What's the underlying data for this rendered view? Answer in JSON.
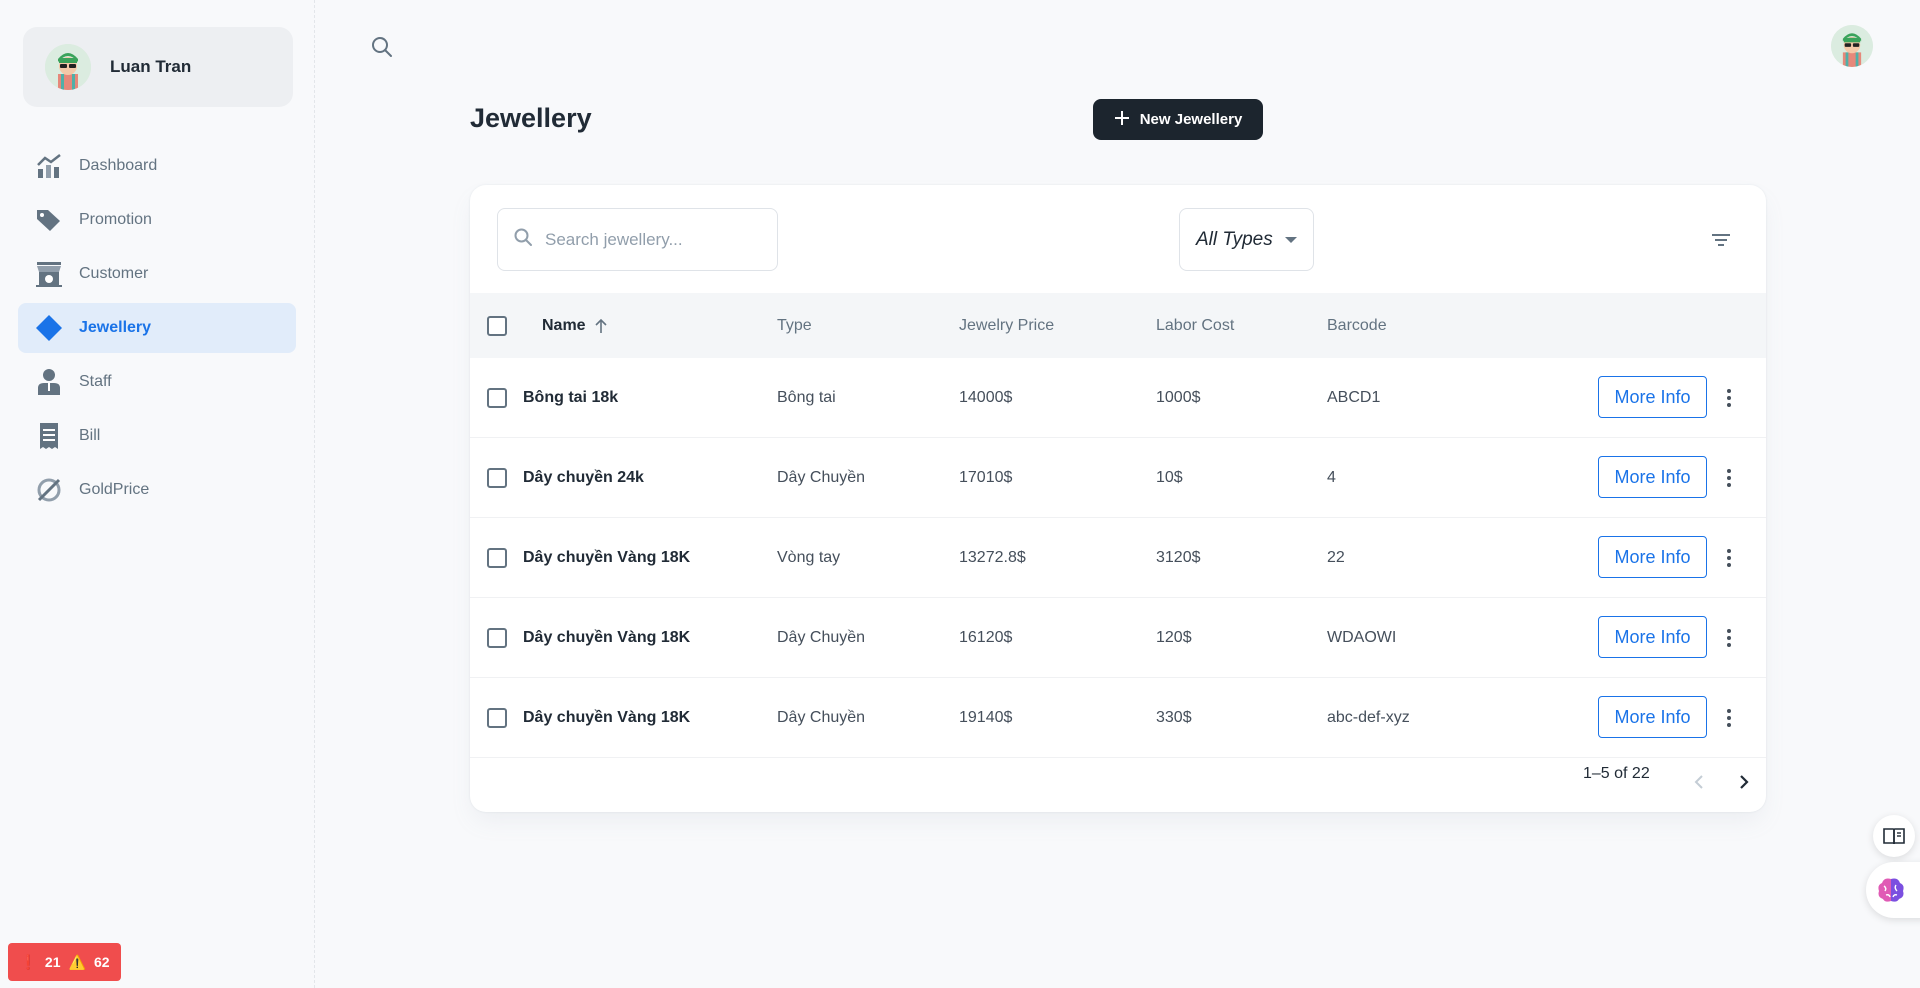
{
  "user": {
    "name": "Luan Tran"
  },
  "sidebar": {
    "items": [
      {
        "label": "Dashboard",
        "icon": "chart-line-icon",
        "active": false
      },
      {
        "label": "Promotion",
        "icon": "tag-icon",
        "active": false
      },
      {
        "label": "Customer",
        "icon": "storefront-icon",
        "active": false
      },
      {
        "label": "Jewellery",
        "icon": "diamond-icon",
        "active": true
      },
      {
        "label": "Staff",
        "icon": "person-badge-icon",
        "active": false
      },
      {
        "label": "Bill",
        "icon": "receipt-icon",
        "active": false
      },
      {
        "label": "GoldPrice",
        "icon": "slashed-circle-icon",
        "active": false
      }
    ]
  },
  "page": {
    "title": "Jewellery",
    "new_button": "New Jewellery"
  },
  "toolbar": {
    "search_placeholder": "Search jewellery...",
    "type_filter": "All Types"
  },
  "table": {
    "columns": [
      "Name",
      "Type",
      "Jewelry Price",
      "Labor Cost",
      "Barcode"
    ],
    "rows": [
      {
        "name": "Bông tai 18k",
        "type": "Bông tai",
        "price": "14000$",
        "labor": "1000$",
        "barcode": "ABCD1"
      },
      {
        "name": "Dây chuyền 24k",
        "type": "Dây Chuyền",
        "price": "17010$",
        "labor": "10$",
        "barcode": "4"
      },
      {
        "name": "Dây chuyền Vàng 18K",
        "type": "Vòng tay",
        "price": "13272.8$",
        "labor": "3120$",
        "barcode": "22"
      },
      {
        "name": "Dây chuyền Vàng 18K",
        "type": "Dây Chuyền",
        "price": "16120$",
        "labor": "120$",
        "barcode": "WDAOWI"
      },
      {
        "name": "Dây chuyền Vàng 18K",
        "type": "Dây Chuyền",
        "price": "19140$",
        "labor": "330$",
        "barcode": "abc-def-xyz"
      }
    ],
    "more_label": "More Info",
    "pagination": "1–5 of 22"
  },
  "error_badge": {
    "errors": "21",
    "warnings": "62"
  },
  "colors": {
    "accent": "#1a73e8",
    "dark_button": "#1c252e",
    "active_nav_bg": "#e1ecfa",
    "error_badge": "#f04d4d"
  }
}
